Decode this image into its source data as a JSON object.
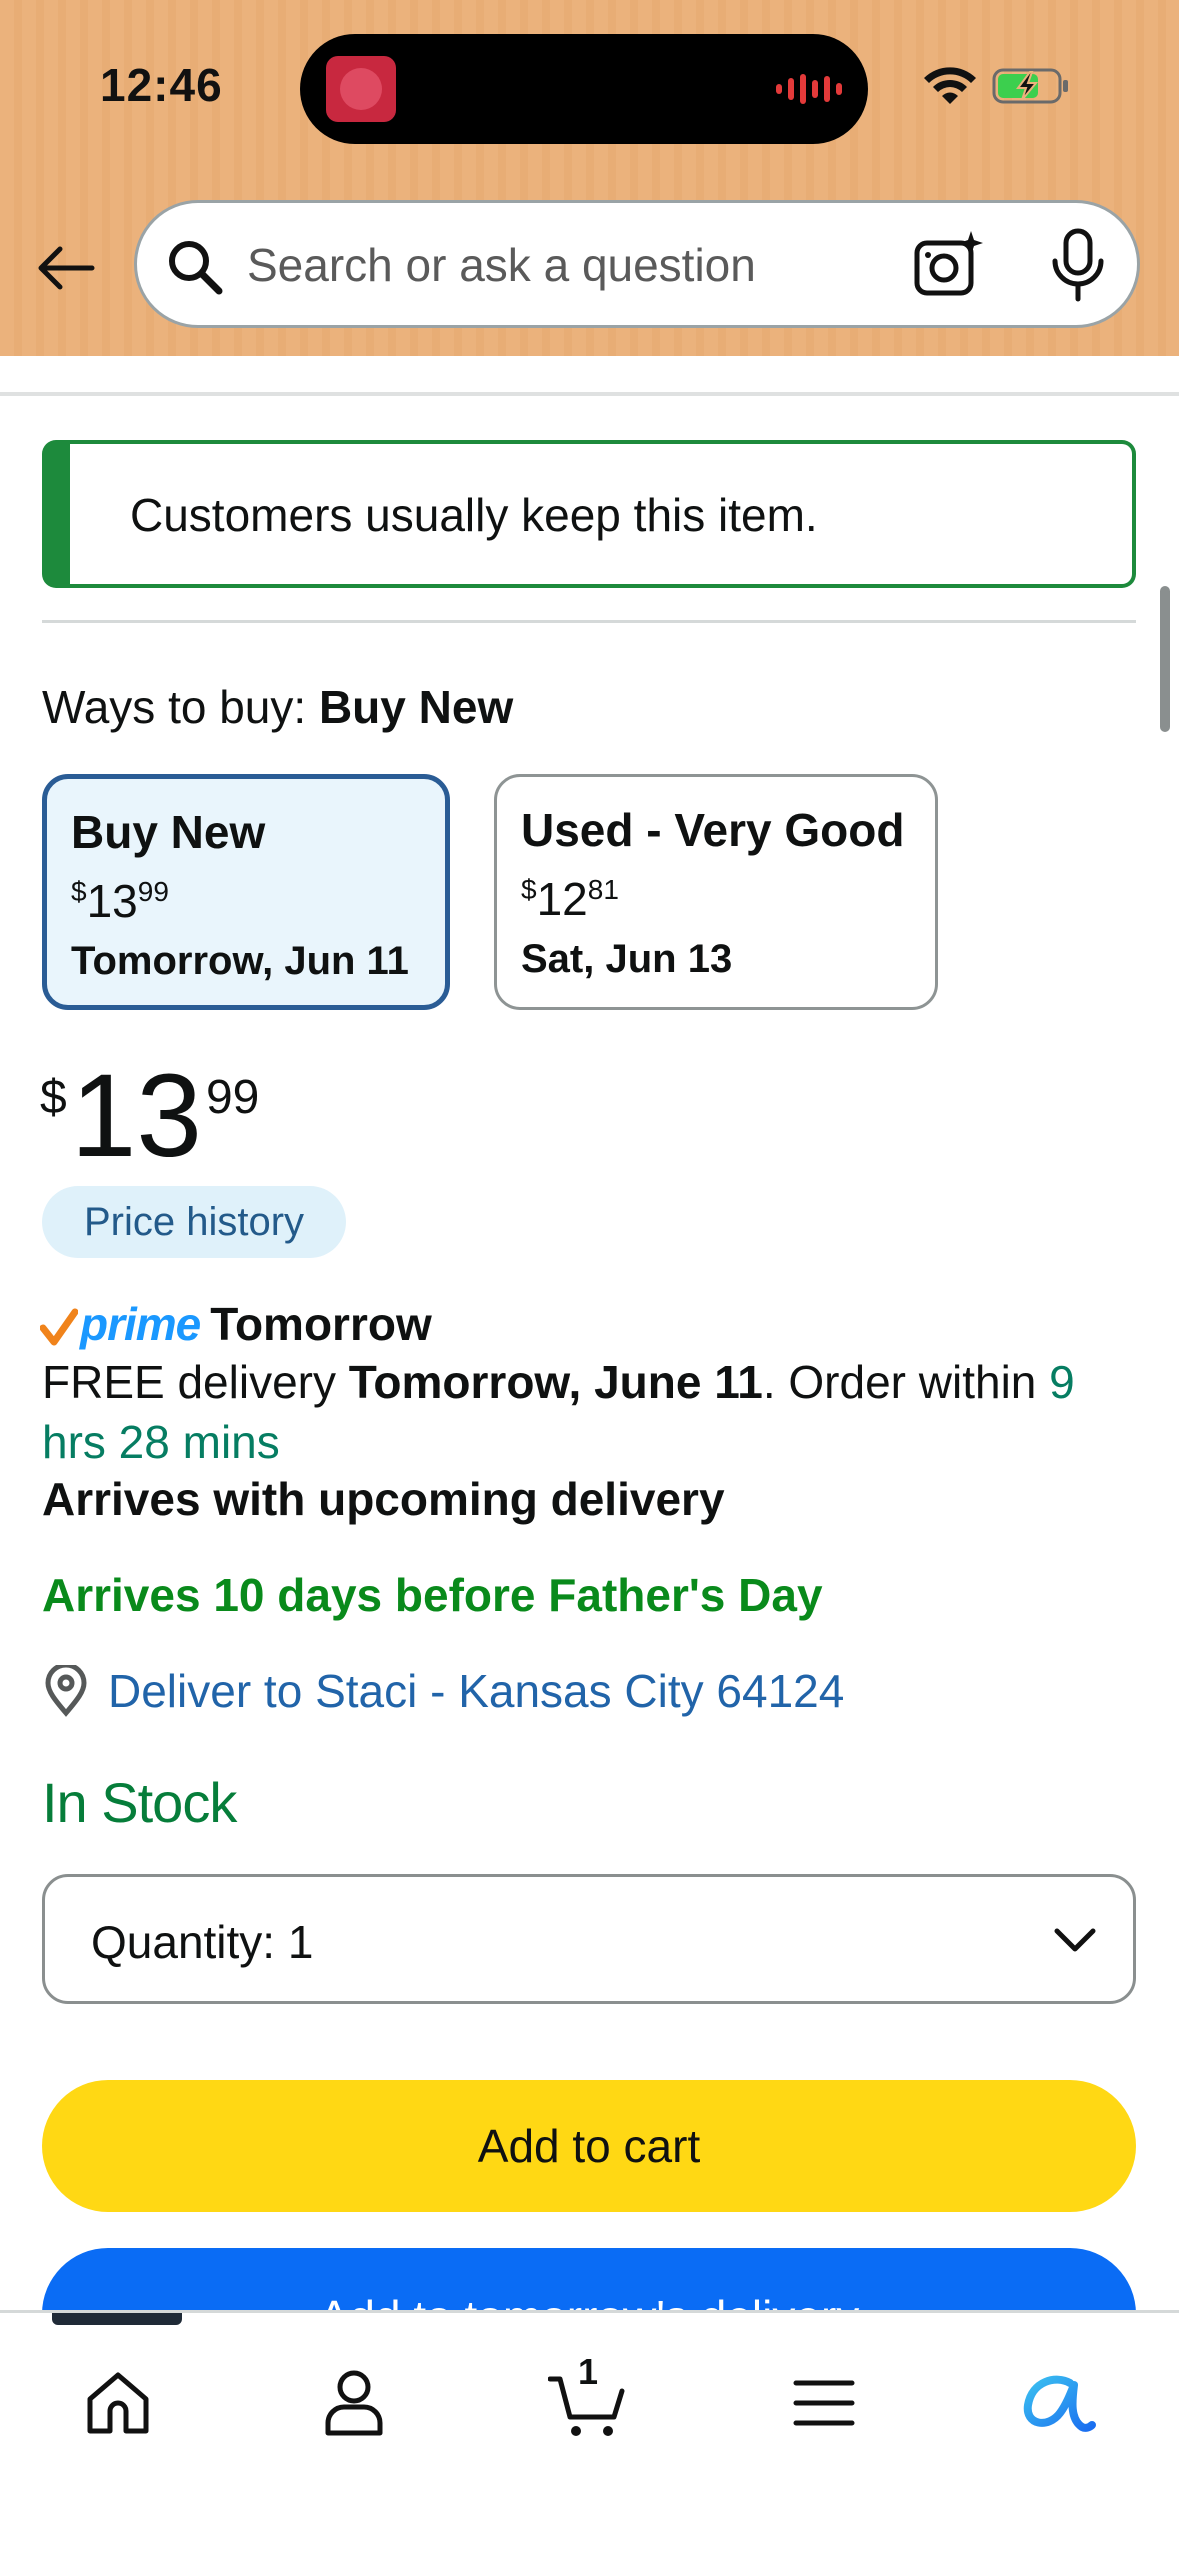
{
  "status_bar": {
    "time": "12:46"
  },
  "search": {
    "placeholder": "Search or ask a question"
  },
  "keep_banner": {
    "text": "Customers usually keep this item."
  },
  "ways_to_buy": {
    "prefix": "Ways to buy: ",
    "selected": "Buy New",
    "options": [
      {
        "title": "Buy New",
        "price_dollars": "13",
        "price_cents": "99",
        "currency": "$",
        "date": "Tomorrow, Jun 11"
      },
      {
        "title": "Used - Very Good",
        "price_dollars": "12",
        "price_cents": "81",
        "currency": "$",
        "date": "Sat, Jun 13"
      }
    ]
  },
  "price": {
    "currency": "$",
    "whole": "13",
    "cents": "99",
    "history_label": "Price history"
  },
  "delivery": {
    "prime_label": "prime",
    "prime_when": "Tomorrow",
    "free_prefix": "FREE delivery ",
    "free_date": "Tomorrow, June 11",
    "order_within_prefix": ". Order within ",
    "countdown": "9 hrs 28 mins",
    "upcoming": "Arrives with upcoming delivery",
    "fathers_day": "Arrives 10 days before Father's Day",
    "deliver_to": "Deliver to Staci - Kansas City 64124"
  },
  "stock": {
    "status": "In Stock",
    "quantity_label": "Quantity:",
    "quantity_value": "1"
  },
  "actions": {
    "add_to_cart": "Add to cart",
    "add_tomorrow": "Add to tomorrow's delivery"
  },
  "bottom_nav": {
    "cart_count": "1",
    "items": [
      "home-icon",
      "account-icon",
      "cart-icon",
      "menu-icon",
      "rufus-icon"
    ]
  },
  "colors": {
    "header": "#EBB27C",
    "keep_green": "#1D8A3C",
    "selected_card_border": "#2A5C95",
    "link_blue": "#2164A9",
    "prime_blue": "#1A98FF",
    "in_stock_green": "#067D3A",
    "add_to_cart_yellow": "#FFD814",
    "add_tomorrow_blue": "#0A6CF5"
  }
}
